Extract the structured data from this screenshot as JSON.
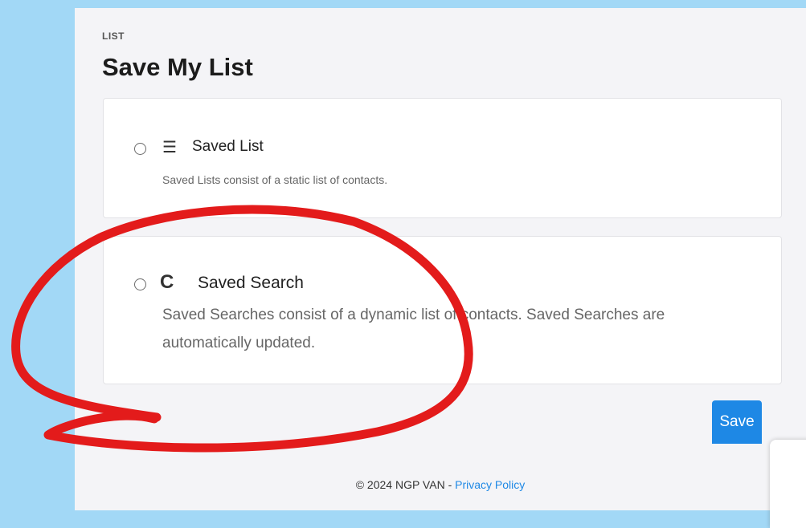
{
  "header": {
    "eyebrow": "LIST",
    "title": "Save My List"
  },
  "options": [
    {
      "icon": "list-icon",
      "title": "Saved List",
      "description": "Saved Lists consist of a static list of contacts.",
      "selected": false
    },
    {
      "icon": "refresh-icon",
      "title": "Saved Search",
      "description": "Saved Searches consist of a dynamic list of contacts. Saved Searches are automatically updated.",
      "selected": false
    }
  ],
  "actions": {
    "save_label": "Save"
  },
  "footer": {
    "copyright": "© 2024 NGP VAN - ",
    "privacy_link": "Privacy Policy"
  },
  "colors": {
    "background": "#a2d8f6",
    "accent": "#1e88e5",
    "annotation": "#e31b1b"
  }
}
